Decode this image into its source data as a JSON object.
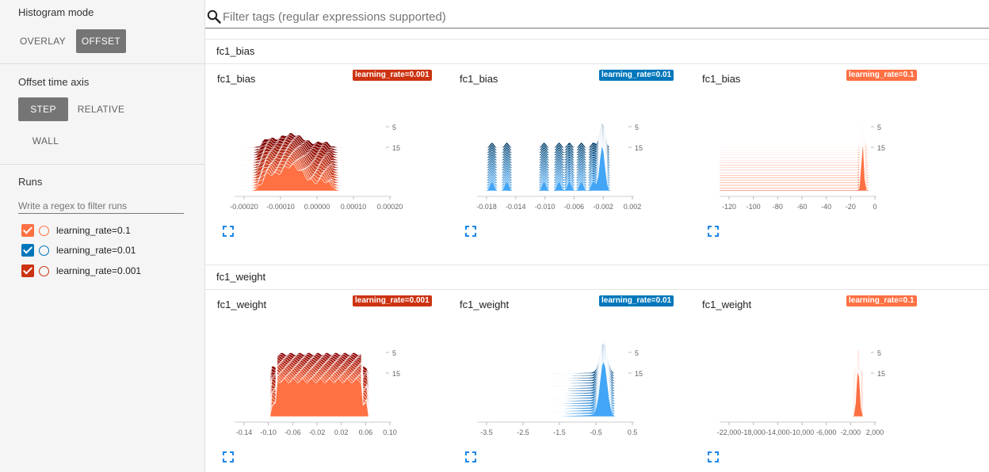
{
  "sidebar": {
    "histogram_mode": {
      "title": "Histogram mode",
      "overlay_label": "OVERLAY",
      "offset_label": "OFFSET",
      "selected": "OFFSET"
    },
    "offset_axis": {
      "title": "Offset time axis",
      "step_label": "STEP",
      "relative_label": "RELATIVE",
      "wall_label": "WALL",
      "selected": "STEP"
    },
    "runs": {
      "title": "Runs",
      "filter_placeholder": "Write a regex to filter runs",
      "items": [
        {
          "label": "learning_rate=0.1",
          "color": "#ff7043",
          "checked": true
        },
        {
          "label": "learning_rate=0.01",
          "color": "#0077bb",
          "checked": true
        },
        {
          "label": "learning_rate=0.001",
          "color": "#cc3311",
          "checked": true
        }
      ]
    }
  },
  "filter": {
    "placeholder": "Filter tags (regular expressions supported)"
  },
  "categories": [
    {
      "name": "fc1_bias",
      "cards": [
        {
          "title": "fc1_bias",
          "run": "learning_rate=0.001",
          "color": "#cc3311",
          "x_ticks": [
            "-0.00020",
            "-0.00010",
            "0.00000",
            "0.00010",
            "0.00020"
          ],
          "y_ticks": [
            "5",
            "15"
          ]
        },
        {
          "title": "fc1_bias",
          "run": "learning_rate=0.01",
          "color": "#0077bb",
          "x_ticks": [
            "-0.018",
            "-0.014",
            "-0.010",
            "-0.006",
            "-0.002",
            "0.002"
          ],
          "y_ticks": [
            "5",
            "15"
          ]
        },
        {
          "title": "fc1_bias",
          "run": "learning_rate=0.1",
          "color": "#ff7043",
          "x_ticks": [
            "-120",
            "-100",
            "-80",
            "-60",
            "-40",
            "-20",
            "0"
          ],
          "y_ticks": [
            "5",
            "15"
          ]
        }
      ]
    },
    {
      "name": "fc1_weight",
      "cards": [
        {
          "title": "fc1_weight",
          "run": "learning_rate=0.001",
          "color": "#cc3311",
          "x_ticks": [
            "-0.14",
            "-0.10",
            "-0.06",
            "-0.02",
            "0.02",
            "0.06",
            "0.10"
          ],
          "y_ticks": [
            "5",
            "15"
          ]
        },
        {
          "title": "fc1_weight",
          "run": "learning_rate=0.01",
          "color": "#0077bb",
          "x_ticks": [
            "-3.5",
            "-2.5",
            "-1.5",
            "-0.5",
            "0.5"
          ],
          "y_ticks": [
            "5",
            "15"
          ]
        },
        {
          "title": "fc1_weight",
          "run": "learning_rate=0.1",
          "color": "#ff7043",
          "x_ticks": [
            "-22,000",
            "-18,000",
            "-14,000",
            "-10,000",
            "-6,000",
            "-2,000",
            "2,000"
          ],
          "y_ticks": [
            "5",
            "15"
          ]
        }
      ]
    }
  ]
}
